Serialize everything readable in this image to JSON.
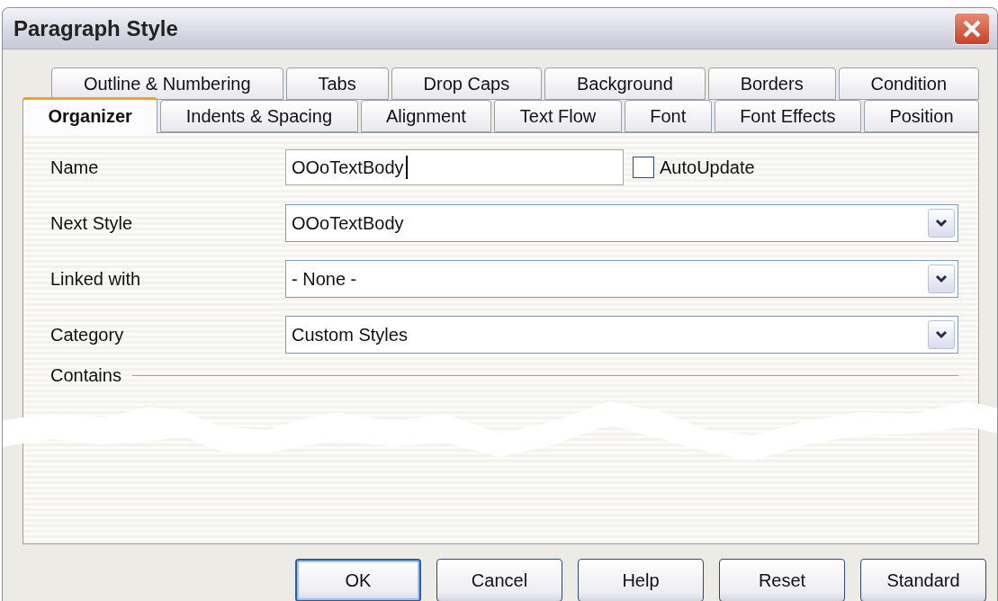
{
  "window": {
    "title": "Paragraph Style"
  },
  "tab_rows": [
    {
      "tabs": [
        {
          "label": "Outline & Numbering",
          "selected": false
        },
        {
          "label": "Tabs",
          "selected": false
        },
        {
          "label": "Drop Caps",
          "selected": false
        },
        {
          "label": "Background",
          "selected": false
        },
        {
          "label": "Borders",
          "selected": false
        },
        {
          "label": "Condition",
          "selected": false
        }
      ]
    },
    {
      "tabs": [
        {
          "label": "Organizer",
          "selected": true
        },
        {
          "label": "Indents & Spacing",
          "selected": false
        },
        {
          "label": "Alignment",
          "selected": false
        },
        {
          "label": "Text Flow",
          "selected": false
        },
        {
          "label": "Font",
          "selected": false
        },
        {
          "label": "Font Effects",
          "selected": false
        },
        {
          "label": "Position",
          "selected": false
        }
      ]
    }
  ],
  "fields": [
    {
      "kind": "text",
      "label": "Name",
      "value": "OOoTextBody",
      "focused": true,
      "checkbox": {
        "label": "AutoUpdate",
        "checked": false
      }
    },
    {
      "kind": "dropdown",
      "label": "Next Style",
      "value": "OOoTextBody"
    },
    {
      "kind": "dropdown",
      "label": "Linked with",
      "value": "- None -"
    },
    {
      "kind": "dropdown",
      "label": "Category",
      "value": "Custom Styles"
    }
  ],
  "contains": {
    "label": "Contains"
  },
  "buttons": [
    {
      "label": "OK",
      "default": true
    },
    {
      "label": "Cancel",
      "default": false
    },
    {
      "label": "Help",
      "default": false
    },
    {
      "label": "Reset",
      "default": false
    },
    {
      "label": "Standard",
      "default": false
    }
  ]
}
